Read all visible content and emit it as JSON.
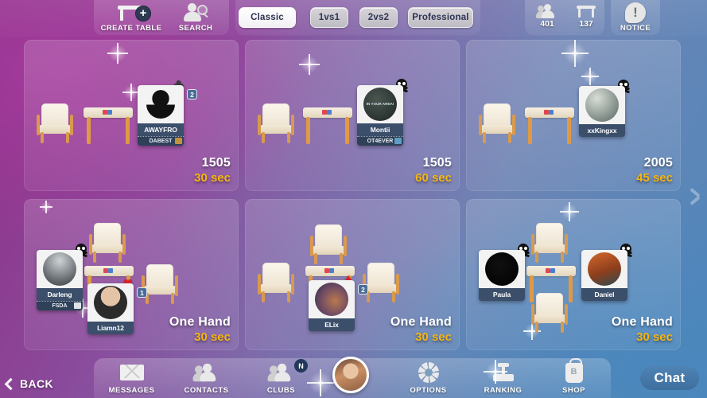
{
  "header": {
    "create_table": {
      "label": "CREATE TABLE",
      "icon": "table-plus-icon"
    },
    "search": {
      "label": "SEARCH",
      "icon": "search-person-icon"
    },
    "filters": [
      {
        "label": "Classic",
        "active": true
      },
      {
        "label": "1vs1",
        "active": false
      },
      {
        "label": "2vs2",
        "active": false
      },
      {
        "label": "Professional",
        "active": false
      }
    ],
    "stats": [
      {
        "icon": "people-icon",
        "value": "401"
      },
      {
        "icon": "table-icon",
        "value": "137"
      }
    ],
    "notice": {
      "label": "NOTICE",
      "icon": "notice-bubble-icon",
      "glyph": "!"
    }
  },
  "tables": [
    {
      "mode": "1505",
      "time": "30 sec",
      "seats": 2,
      "players": [
        {
          "name": "AWAYFRO",
          "club": "DABEST",
          "skull": false,
          "suit": {
            "glyph": "♣",
            "count": "2",
            "color": "#3a3a3a"
          },
          "avatar": "silhouette"
        }
      ]
    },
    {
      "mode": "1505",
      "time": "60 sec",
      "seats": 2,
      "players": [
        {
          "name": "Montii",
          "club": "OT4EVER",
          "skull": true,
          "suit": null,
          "avatar": "dark-circle-photo",
          "avatar_text": "IN YOUR AREA!"
        }
      ]
    },
    {
      "mode": "2005",
      "time": "45 sec",
      "seats": 2,
      "players": [
        {
          "name": "xxKingxx",
          "club": null,
          "skull": true,
          "suit": null,
          "avatar": "grey-sphere"
        }
      ]
    },
    {
      "mode": "One Hand",
      "time": "30 sec",
      "seats": 4,
      "players": [
        {
          "name": "Darleng",
          "club": "FSDA",
          "skull": true,
          "suit": null,
          "avatar": "person-photo-grey"
        },
        {
          "name": "Liamn12",
          "club": null,
          "skull": false,
          "suit": {
            "glyph": "♥",
            "count": "1",
            "color": "#d8232a"
          },
          "avatar": "man-glasses-photo"
        }
      ]
    },
    {
      "mode": "One Hand",
      "time": "30 sec",
      "seats": 4,
      "players": [
        {
          "name": "ELix",
          "club": null,
          "skull": false,
          "suit": {
            "glyph": "♦",
            "count": "2",
            "color": "#d8232a"
          },
          "avatar": "woman-cap-photo"
        }
      ]
    },
    {
      "mode": "One Hand",
      "time": "30 sec",
      "seats": 4,
      "players": [
        {
          "name": "Paula",
          "club": null,
          "skull": true,
          "suit": null,
          "avatar": "black-circle-photo"
        },
        {
          "name": "Daniel",
          "club": null,
          "skull": true,
          "suit": null,
          "avatar": "orange-photo"
        }
      ]
    }
  ],
  "footer": {
    "back": {
      "label": "BACK",
      "icon": "chevron-left-icon"
    },
    "items": [
      {
        "label": "MESSAGES",
        "icon": "envelope-icon",
        "badge": null
      },
      {
        "label": "CONTACTS",
        "icon": "contacts-icon",
        "badge": null
      },
      {
        "label": "CLUBS",
        "icon": "clubs-icon",
        "badge": "N"
      },
      {
        "label": "OPTIONS",
        "icon": "gear-icon",
        "badge": null
      },
      {
        "label": "RANKING",
        "icon": "podium-icon",
        "badge": null
      },
      {
        "label": "SHOP",
        "icon": "shopping-bag-icon",
        "badge": null
      }
    ],
    "avatar": "user-avatar",
    "chat": {
      "label": "Chat"
    }
  },
  "colors": {
    "accent_time": "#f5b513",
    "card_name_bg": "#3b4f6b",
    "chat_bg": "#4e83b4"
  }
}
